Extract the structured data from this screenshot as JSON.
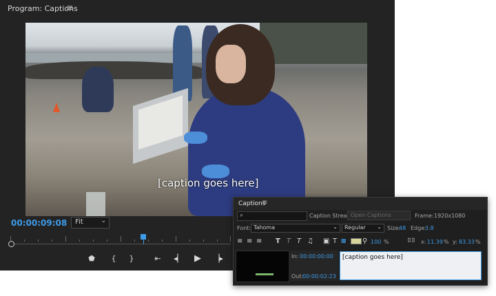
{
  "monitor": {
    "title": "Program: Captions",
    "menu_icon": "hamburger-icon",
    "video_caption": "[caption goes here]",
    "timecode": "00:00:09:08",
    "fit": "Fit"
  },
  "transport": {
    "icons": [
      "marker-icon",
      "mark-in-icon",
      "mark-out-icon",
      "go-to-in-icon",
      "step-back-icon",
      "play-icon",
      "step-forward-icon"
    ]
  },
  "captions_panel": {
    "tab": "Captions",
    "caption_stream_label": "Caption Stream:",
    "caption_stream_value": "Open Captions",
    "frame_label": "Frame:",
    "frame_value": "1920x1080",
    "font_label": "Font:",
    "font_value": "Tahoma",
    "style_value": "Regular",
    "size_label": "Size:",
    "size_value": "48",
    "edge_label": "Edge:",
    "edge_value": "3.8",
    "opacity_value": "100",
    "percent": "%",
    "x_label": "x:",
    "x_value": "11.39",
    "y_label": "y:",
    "y_value": "83.33",
    "in_label": "In:",
    "in_value": "00:00:00:00",
    "out_label": "Out:",
    "out_value": "00:00:02:23",
    "caption_text": "[caption goes here]"
  }
}
